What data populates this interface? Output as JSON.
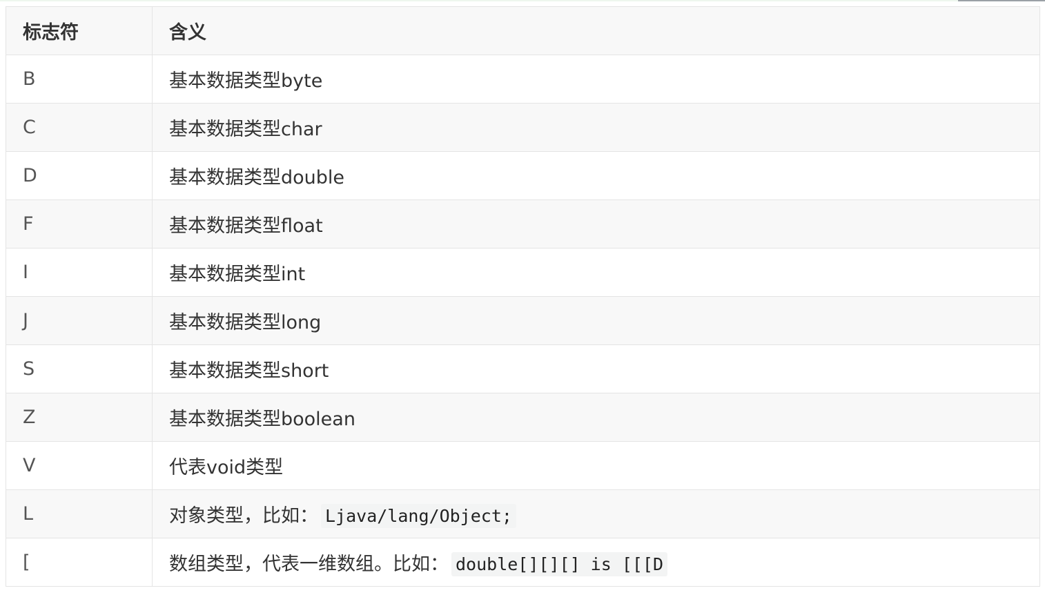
{
  "table": {
    "headers": [
      "标志符",
      "含义"
    ],
    "rows": [
      {
        "flag": "B",
        "meaning": "基本数据类型byte",
        "code": ""
      },
      {
        "flag": "C",
        "meaning": "基本数据类型char",
        "code": ""
      },
      {
        "flag": "D",
        "meaning": "基本数据类型double",
        "code": ""
      },
      {
        "flag": "F",
        "meaning": "基本数据类型float",
        "code": ""
      },
      {
        "flag": "I",
        "meaning": "基本数据类型int",
        "code": ""
      },
      {
        "flag": "J",
        "meaning": "基本数据类型long",
        "code": ""
      },
      {
        "flag": "S",
        "meaning": "基本数据类型short",
        "code": ""
      },
      {
        "flag": "Z",
        "meaning": "基本数据类型boolean",
        "code": ""
      },
      {
        "flag": "V",
        "meaning": "代表void类型",
        "code": ""
      },
      {
        "flag": "L",
        "meaning": "对象类型，比如：",
        "code": "Ljava/lang/Object;"
      },
      {
        "flag": "[",
        "meaning": "数组类型，代表一维数组。比如：",
        "code": "double[][][] is [[[D"
      }
    ]
  }
}
